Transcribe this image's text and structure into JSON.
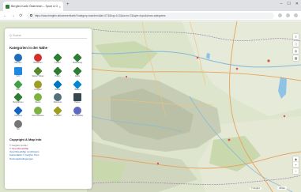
{
  "browser": {
    "tab_title": "Bergfex Karte Österreich – Sport & Outdoor",
    "url": "https://www.bergfex.at/sommer/karte/?category=wandern&lat=47.5&lng=14.5&zoom=7&layer=topo&show=categories",
    "close_tab": "×",
    "new_tab": "+",
    "window_min": "–",
    "window_max": "☐",
    "window_close": "✕",
    "back": "←",
    "forward": "→",
    "reload": "⟳"
  },
  "panel": {
    "search_placeholder": "Q Suche",
    "heading": "Kategorien in der Nähe",
    "categories": [
      {
        "label": "Wandern",
        "color": "#1e6fb8",
        "shape": "circle",
        "icon": "hiking-icon"
      },
      {
        "label": "Radfahren",
        "color": "#d32f2f",
        "shape": "circle",
        "icon": "cycling-icon"
      },
      {
        "label": "Laufen",
        "color": "#2e7d32",
        "shape": "diamond",
        "icon": "running-icon"
      },
      {
        "label": "Klettersteig",
        "color": "#2e7d32",
        "shape": "diamond",
        "icon": "climbing-icon"
      },
      {
        "label": "Schi",
        "color": "#1e88e5",
        "shape": "square",
        "icon": "ski-icon"
      },
      {
        "label": "Skitour Winter",
        "color": "#558b2f",
        "shape": "diamond",
        "icon": "skitour-icon"
      },
      {
        "label": "Hütten",
        "color": "#2e7d32",
        "shape": "diamond",
        "icon": "hut-icon"
      },
      {
        "label": "Gipfel",
        "color": "#2e7d32",
        "shape": "diamond",
        "icon": "peak-icon"
      },
      {
        "label": "Seen",
        "color": "#43a047",
        "shape": "diamond",
        "icon": "lake-icon"
      },
      {
        "label": "Langlauf",
        "color": "#9e9d24",
        "shape": "circle",
        "icon": "crosscountry-icon"
      },
      {
        "label": "Rodeln",
        "color": "#0277bd",
        "shape": "diamond",
        "icon": "sled-icon"
      },
      {
        "label": "Baden",
        "color": "#0288d1",
        "shape": "diamond",
        "icon": "swim-icon"
      },
      {
        "label": "Bergbahnen",
        "color": "#2e7d32",
        "shape": "diamond",
        "icon": "lift-icon"
      },
      {
        "label": "Wetter",
        "color": "#7cb342",
        "shape": "circle",
        "icon": "weather-icon"
      },
      {
        "label": "Webcams",
        "color": "#546e7a",
        "shape": "circle",
        "icon": "webcam-icon"
      },
      {
        "label": "Parken",
        "color": "#37474f",
        "shape": "square",
        "icon": "parking-icon"
      },
      {
        "label": "Camping",
        "color": "#1565c0",
        "shape": "diamond",
        "icon": "camping-icon"
      },
      {
        "label": "Sehenswertes",
        "color": "#7cb342",
        "shape": "circle",
        "icon": "sight-icon"
      },
      {
        "label": "Aussicht",
        "color": "#9e9d24",
        "shape": "diamond",
        "icon": "view-icon"
      },
      {
        "label": "Mountainbike",
        "color": "#5c6bc0",
        "shape": "circle",
        "icon": "mtb-icon"
      },
      {
        "label": "Alle",
        "color": "#757575",
        "shape": "circle",
        "icon": "all-icon"
      }
    ],
    "copyright_heading": "Copyright & Map Info",
    "links": [
      {
        "text": "© bergfex GmbH",
        "style": "plain"
      },
      {
        "text": "© OpenStreetMap",
        "style": "pink"
      },
      {
        "text": "OpenStreetMap contributors",
        "style": "link"
      },
      {
        "text": "Kartendaten © bergfex Topo",
        "style": "link"
      },
      {
        "text": "Nutzungsbedingungen",
        "style": "link"
      }
    ]
  },
  "map": {
    "scale_label": "20 km",
    "attribution": "© bergfex",
    "zoom_in": "+",
    "zoom_out": "−",
    "compass": "◈"
  }
}
